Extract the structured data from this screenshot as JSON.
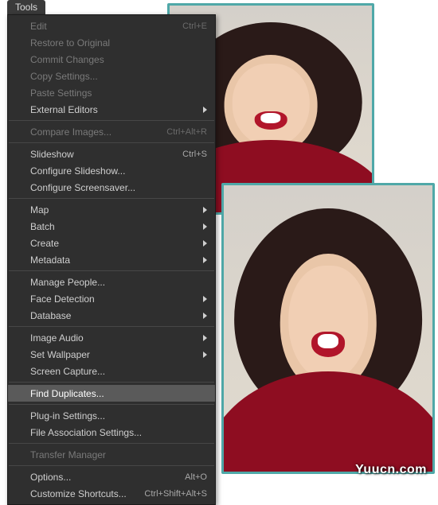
{
  "watermark": "Yuucn.com",
  "menu_tab": "Tools",
  "menu": {
    "items": [
      {
        "kind": "item",
        "label": "Edit",
        "shortcut": "Ctrl+E",
        "submenu": false,
        "disabled": true
      },
      {
        "kind": "item",
        "label": "Restore to Original",
        "submenu": false,
        "disabled": true
      },
      {
        "kind": "item",
        "label": "Commit Changes",
        "submenu": false,
        "disabled": true
      },
      {
        "kind": "item",
        "label": "Copy Settings...",
        "submenu": false,
        "disabled": true
      },
      {
        "kind": "item",
        "label": "Paste Settings",
        "submenu": false,
        "disabled": true
      },
      {
        "kind": "item",
        "label": "External Editors",
        "submenu": true,
        "disabled": false
      },
      {
        "kind": "sep"
      },
      {
        "kind": "item",
        "label": "Compare Images...",
        "shortcut": "Ctrl+Alt+R",
        "submenu": false,
        "disabled": true
      },
      {
        "kind": "sep"
      },
      {
        "kind": "item",
        "label": "Slideshow",
        "shortcut": "Ctrl+S",
        "submenu": false,
        "disabled": false
      },
      {
        "kind": "item",
        "label": "Configure Slideshow...",
        "submenu": false,
        "disabled": false
      },
      {
        "kind": "item",
        "label": "Configure Screensaver...",
        "submenu": false,
        "disabled": false
      },
      {
        "kind": "sep"
      },
      {
        "kind": "item",
        "label": "Map",
        "submenu": true,
        "disabled": false
      },
      {
        "kind": "item",
        "label": "Batch",
        "submenu": true,
        "disabled": false
      },
      {
        "kind": "item",
        "label": "Create",
        "submenu": true,
        "disabled": false
      },
      {
        "kind": "item",
        "label": "Metadata",
        "submenu": true,
        "disabled": false
      },
      {
        "kind": "sep"
      },
      {
        "kind": "item",
        "label": "Manage People...",
        "submenu": false,
        "disabled": false
      },
      {
        "kind": "item",
        "label": "Face Detection",
        "submenu": true,
        "disabled": false
      },
      {
        "kind": "item",
        "label": "Database",
        "submenu": true,
        "disabled": false
      },
      {
        "kind": "sep"
      },
      {
        "kind": "item",
        "label": "Image Audio",
        "submenu": true,
        "disabled": false
      },
      {
        "kind": "item",
        "label": "Set Wallpaper",
        "submenu": true,
        "disabled": false
      },
      {
        "kind": "item",
        "label": "Screen Capture...",
        "submenu": false,
        "disabled": false
      },
      {
        "kind": "sep"
      },
      {
        "kind": "item",
        "label": "Find Duplicates...",
        "submenu": false,
        "disabled": false,
        "highlight": true
      },
      {
        "kind": "sep"
      },
      {
        "kind": "item",
        "label": "Plug-in Settings...",
        "submenu": false,
        "disabled": false
      },
      {
        "kind": "item",
        "label": "File Association Settings...",
        "submenu": false,
        "disabled": false
      },
      {
        "kind": "sep"
      },
      {
        "kind": "item",
        "label": "Transfer Manager",
        "submenu": false,
        "disabled": true
      },
      {
        "kind": "sep"
      },
      {
        "kind": "item",
        "label": "Options...",
        "shortcut": "Alt+O",
        "submenu": false,
        "disabled": false
      },
      {
        "kind": "item",
        "label": "Customize Shortcuts...",
        "shortcut": "Ctrl+Shift+Alt+S",
        "submenu": false,
        "disabled": false
      }
    ]
  }
}
